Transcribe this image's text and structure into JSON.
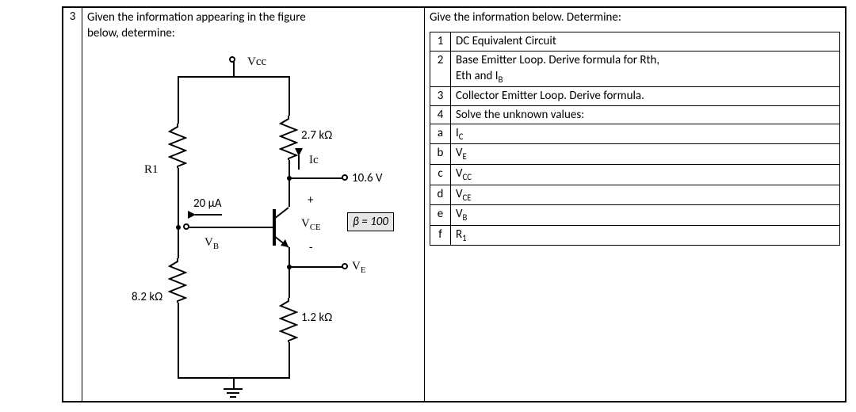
{
  "question_number": "3",
  "left_prompt_a": "Given the information appearing in the figure",
  "left_prompt_b": "below, determine:",
  "right_prompt": "Give the information below.  Determine:",
  "circuit": {
    "vcc": "Vcc",
    "r1_label": "R1",
    "r_collector": "2.7 kΩ",
    "r_lower_left": "8.2 kΩ",
    "r_emitter": "1.2 kΩ",
    "ib_value": "20 µA",
    "ic_label": "Ic",
    "vce_plus": "+",
    "vce_minus": "-",
    "vce_label": "V",
    "vce_sub": "CE",
    "vce_value": "10.6  V",
    "vb_label": "V",
    "vb_sub": "B",
    "ve_label": "V",
    "ve_sub": "E",
    "beta": "β = 100"
  },
  "tasks": [
    {
      "idx": "1",
      "text": "DC Equivalent Circuit"
    },
    {
      "idx": "2",
      "text_a": "Base Emitter Loop. Derive formula for Rth,",
      "text_b": "Eth and I",
      "text_b_sub": "B"
    },
    {
      "idx": "3",
      "text": "Collector Emitter Loop.  Derive formula."
    },
    {
      "idx": "4",
      "text": "Solve the unknown values:"
    },
    {
      "idx": "a",
      "text": "I",
      "sub": "C"
    },
    {
      "idx": "b",
      "text": "V",
      "sub": "E"
    },
    {
      "idx": "c",
      "text": "V",
      "sub": "CC"
    },
    {
      "idx": "d",
      "text": "V",
      "sub": "CE"
    },
    {
      "idx": "e",
      "text": "V",
      "sub": "B"
    },
    {
      "idx": "f",
      "text": "R",
      "sub": "1"
    }
  ]
}
